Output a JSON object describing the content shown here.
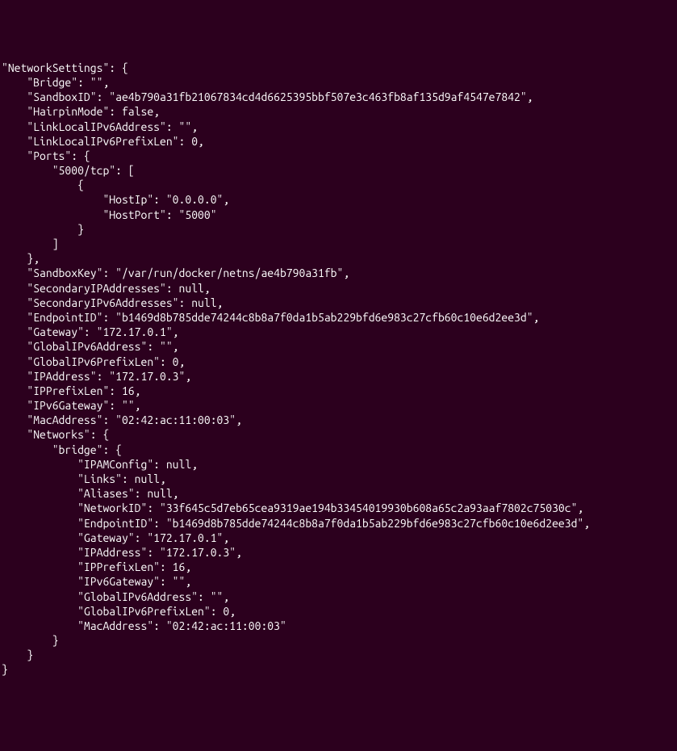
{
  "lines": [
    "\"NetworkSettings\": {",
    "    \"Bridge\": \"\",",
    "    \"SandboxID\": \"ae4b790a31fb21067834cd4d6625395bbf507e3c463fb8af135d9af4547e7842\",",
    "    \"HairpinMode\": false,",
    "    \"LinkLocalIPv6Address\": \"\",",
    "    \"LinkLocalIPv6PrefixLen\": 0,",
    "    \"Ports\": {",
    "        \"5000/tcp\": [",
    "            {",
    "                \"HostIp\": \"0.0.0.0\",",
    "                \"HostPort\": \"5000\"",
    "            }",
    "        ]",
    "    },",
    "    \"SandboxKey\": \"/var/run/docker/netns/ae4b790a31fb\",",
    "    \"SecondaryIPAddresses\": null,",
    "    \"SecondaryIPv6Addresses\": null,",
    "    \"EndpointID\": \"b1469d8b785dde74244c8b8a7f0da1b5ab229bfd6e983c27cfb60c10e6d2ee3d\",",
    "    \"Gateway\": \"172.17.0.1\",",
    "    \"GlobalIPv6Address\": \"\",",
    "    \"GlobalIPv6PrefixLen\": 0,",
    "    \"IPAddress\": \"172.17.0.3\",",
    "    \"IPPrefixLen\": 16,",
    "    \"IPv6Gateway\": \"\",",
    "    \"MacAddress\": \"02:42:ac:11:00:03\",",
    "    \"Networks\": {",
    "        \"bridge\": {",
    "            \"IPAMConfig\": null,",
    "            \"Links\": null,",
    "            \"Aliases\": null,",
    "            \"NetworkID\": \"33f645c5d7eb65cea9319ae194b33454019930b608a65c2a93aaf7802c75030c\",",
    "            \"EndpointID\": \"b1469d8b785dde74244c8b8a7f0da1b5ab229bfd6e983c27cfb60c10e6d2ee3d\",",
    "            \"Gateway\": \"172.17.0.1\",",
    "            \"IPAddress\": \"172.17.0.3\",",
    "            \"IPPrefixLen\": 16,",
    "            \"IPv6Gateway\": \"\",",
    "            \"GlobalIPv6Address\": \"\",",
    "            \"GlobalIPv6PrefixLen\": 0,",
    "            \"MacAddress\": \"02:42:ac:11:00:03\"",
    "        }",
    "    }",
    "}"
  ]
}
